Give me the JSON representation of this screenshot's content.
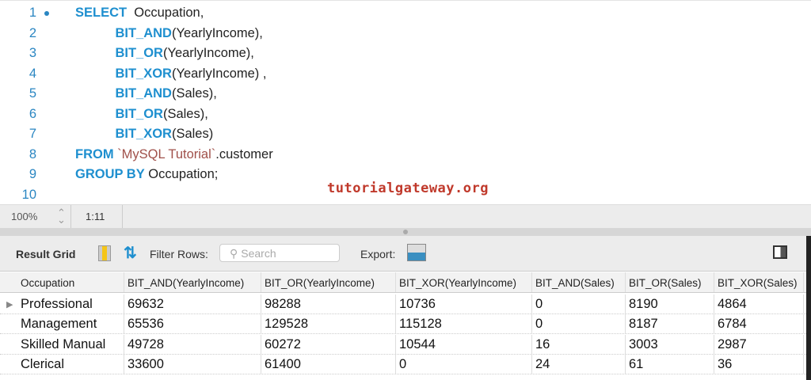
{
  "editor": {
    "lines": [
      {
        "n": "1",
        "parts": [
          [
            "kw",
            "SELECT"
          ],
          [
            "",
            "  Occupation,"
          ]
        ]
      },
      {
        "n": "2",
        "parts": [
          [
            "",
            "           "
          ],
          [
            "kw",
            "BIT_AND"
          ],
          [
            "",
            "(YearlyIncome),"
          ]
        ]
      },
      {
        "n": "3",
        "parts": [
          [
            "",
            "           "
          ],
          [
            "kw",
            "BIT_OR"
          ],
          [
            "",
            "(YearlyIncome),"
          ]
        ]
      },
      {
        "n": "4",
        "parts": [
          [
            "",
            "           "
          ],
          [
            "kw",
            "BIT_XOR"
          ],
          [
            "",
            "(YearlyIncome) ,"
          ]
        ]
      },
      {
        "n": "5",
        "parts": [
          [
            "",
            "           "
          ],
          [
            "kw",
            "BIT_AND"
          ],
          [
            "",
            "(Sales),"
          ]
        ]
      },
      {
        "n": "6",
        "parts": [
          [
            "",
            "           "
          ],
          [
            "kw",
            "BIT_OR"
          ],
          [
            "",
            "(Sales),"
          ]
        ]
      },
      {
        "n": "7",
        "parts": [
          [
            "",
            "           "
          ],
          [
            "kw",
            "BIT_XOR"
          ],
          [
            "",
            "(Sales)"
          ]
        ]
      },
      {
        "n": "8",
        "parts": [
          [
            "kw",
            "FROM"
          ],
          [
            "",
            " "
          ],
          [
            "str",
            "`MySQL Tutorial`"
          ],
          [
            "",
            ".customer"
          ]
        ]
      },
      {
        "n": "9",
        "parts": [
          [
            "kw",
            "GROUP BY"
          ],
          [
            "",
            " Occupation;"
          ]
        ]
      },
      {
        "n": "10",
        "parts": []
      }
    ],
    "watermark": "tutorialgateway.org"
  },
  "status": {
    "zoom": "100%",
    "position": "1:11"
  },
  "toolbar": {
    "result_grid": "Result Grid",
    "filter_rows": "Filter Rows:",
    "search_placeholder": "Search",
    "export": "Export:"
  },
  "grid": {
    "columns": [
      "Occupation",
      "BIT_AND(YearlyIncome)",
      "BIT_OR(YearlyIncome)",
      "BIT_XOR(YearlyIncome)",
      "BIT_AND(Sales)",
      "BIT_OR(Sales)",
      "BIT_XOR(Sales)"
    ],
    "rows": [
      [
        "Professional",
        "69632",
        "98288",
        "10736",
        "0",
        "8190",
        "4864"
      ],
      [
        "Management",
        "65536",
        "129528",
        "115128",
        "0",
        "8187",
        "6784"
      ],
      [
        "Skilled Manual",
        "49728",
        "60272",
        "10544",
        "16",
        "3003",
        "2987"
      ],
      [
        "Clerical",
        "33600",
        "61400",
        "0",
        "24",
        "61",
        "36"
      ]
    ]
  }
}
